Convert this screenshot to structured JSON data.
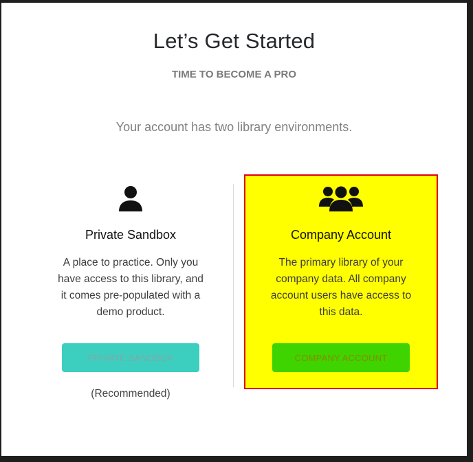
{
  "header": {
    "title": "Let’s Get Started",
    "subtitle": "TIME TO BECOME A PRO",
    "intro": "Your account has two library environments."
  },
  "options": {
    "sandbox": {
      "icon": "user-icon",
      "title": "Private Sandbox",
      "description": "A place to practice. Only you have access to this library, and it comes pre-populated with a demo product.",
      "button_label": "PRIVATE SANDBOX",
      "note": "(Recommended)",
      "button_color": "#3ccfc0"
    },
    "company": {
      "icon": "users-group-icon",
      "title": "Company Account",
      "description": "The primary library of your company data. All company account users have access to this data.",
      "button_label": "COMPANY ACCOUNT",
      "button_color": "#3fd300",
      "highlight_color": "#ffff00",
      "highlight_border": "#e0001b"
    }
  }
}
